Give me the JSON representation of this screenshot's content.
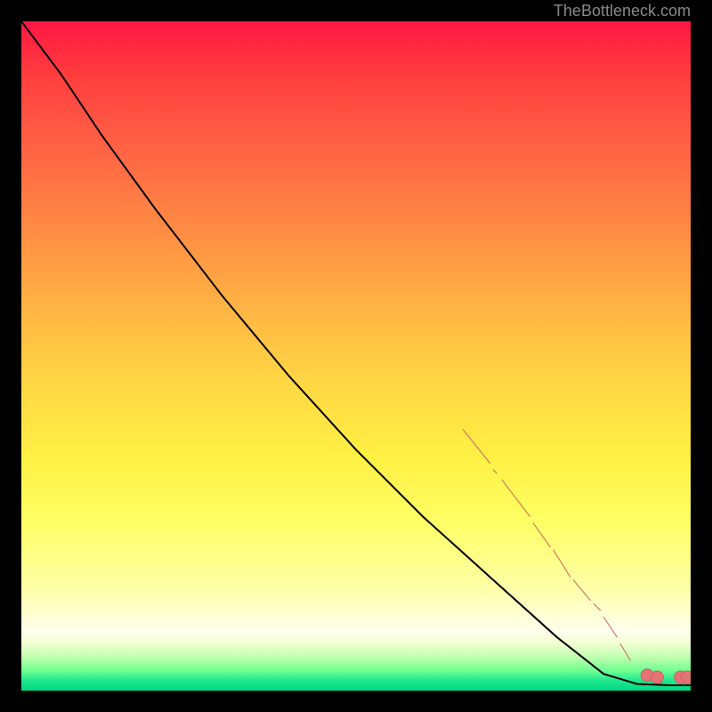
{
  "attribution": "TheBottleneck.com",
  "chart_data": {
    "type": "line",
    "title": "",
    "xlabel": "",
    "ylabel": "",
    "xlim": [
      0,
      100
    ],
    "ylim": [
      0,
      100
    ],
    "curve": [
      {
        "x": 0,
        "y": 100
      },
      {
        "x": 6,
        "y": 92
      },
      {
        "x": 12,
        "y": 83
      },
      {
        "x": 20,
        "y": 72
      },
      {
        "x": 30,
        "y": 59
      },
      {
        "x": 40,
        "y": 47
      },
      {
        "x": 50,
        "y": 36
      },
      {
        "x": 60,
        "y": 26
      },
      {
        "x": 70,
        "y": 17
      },
      {
        "x": 80,
        "y": 8
      },
      {
        "x": 87,
        "y": 2.5
      },
      {
        "x": 92,
        "y": 1
      },
      {
        "x": 97,
        "y": 0.8
      },
      {
        "x": 100,
        "y": 0.8
      }
    ],
    "data_clusters": [
      {
        "x1": 66,
        "y1": 39,
        "x2": 70,
        "y2": 34
      },
      {
        "x1": 70.5,
        "y1": 33,
        "x2": 71,
        "y2": 32.5
      },
      {
        "x1": 71.8,
        "y1": 31.5,
        "x2": 76,
        "y2": 26
      },
      {
        "x1": 76.5,
        "y1": 25,
        "x2": 79,
        "y2": 21.5
      },
      {
        "x1": 79.5,
        "y1": 21,
        "x2": 82,
        "y2": 17
      },
      {
        "x1": 82.5,
        "y1": 16.5,
        "x2": 85,
        "y2": 13.5
      },
      {
        "x1": 85.5,
        "y1": 13,
        "x2": 86.5,
        "y2": 12
      },
      {
        "x1": 87,
        "y1": 11,
        "x2": 89,
        "y2": 8
      },
      {
        "x1": 89.5,
        "y1": 7,
        "x2": 91,
        "y2": 4.5
      }
    ],
    "data_points": [
      {
        "x": 93.5,
        "y": 2.3
      },
      {
        "x": 95,
        "y": 2
      },
      {
        "x": 98.5,
        "y": 2
      },
      {
        "x": 99.5,
        "y": 2
      }
    ]
  }
}
